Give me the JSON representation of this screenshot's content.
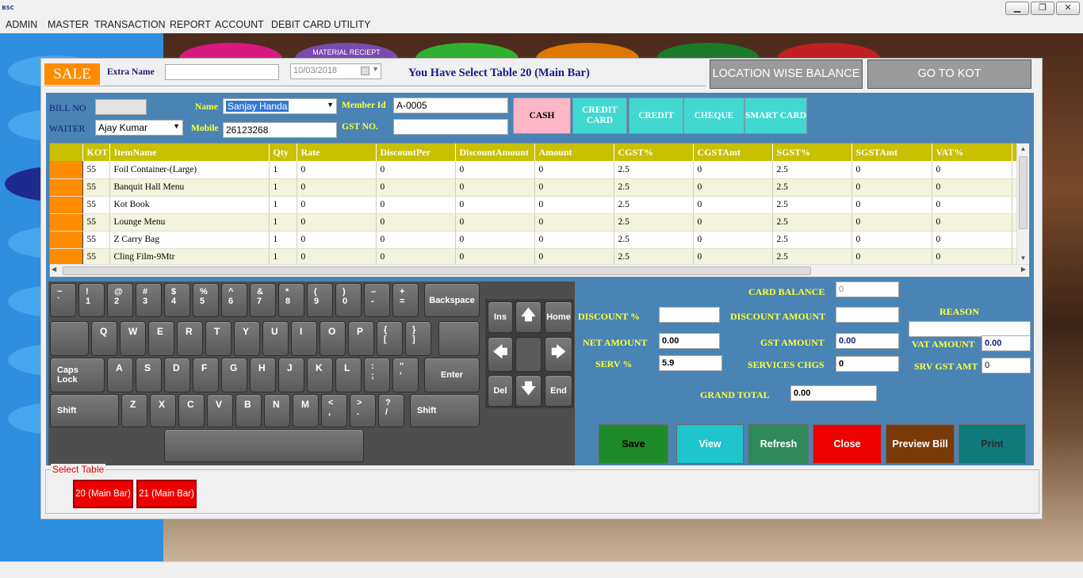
{
  "app": {
    "icon_text": "BSC"
  },
  "window_controls": {
    "minimize": "▁",
    "restore": "❐",
    "close": "✕"
  },
  "menu": [
    "ADMIN",
    "MASTER",
    "TRANSACTION",
    "REPORT",
    "ACCOUNT",
    "DEBIT CARD",
    "UTILITY"
  ],
  "background_fragment": "MATERIAL RECIEPT",
  "header": {
    "sale_label": "SALE",
    "extra_name_label": "Extra Name",
    "extra_name_value": "",
    "date_value": "10/03/2018",
    "table_message": "You Have Select Table 20 (Main Bar)",
    "location_balance_label": "LOCATION WISE BALANCE",
    "go_to_kot_label": "GO TO KOT"
  },
  "form": {
    "bill_no_label": "BILL NO",
    "bill_no_value": "",
    "waiter_label": "WAITER",
    "waiter_value": "Ajay Kumar",
    "name_label": "Name",
    "name_value": "Sanjay  Handa",
    "mobile_label": "Mobile",
    "mobile_value": "26123268",
    "member_id_label": "Member Id",
    "member_id_value": "A-0005",
    "gst_no_label": "GST NO.",
    "gst_no_value": ""
  },
  "payment_modes": [
    {
      "label": "CASH",
      "color": "#ffb6c6",
      "text_color": "#000000"
    },
    {
      "label": "CREDIT CARD",
      "color": "#40d8d0",
      "text_color": "#ffffff"
    },
    {
      "label": "CREDIT",
      "color": "#40d8d0",
      "text_color": "#ffffff"
    },
    {
      "label": "CHEQUE",
      "color": "#40d8d0",
      "text_color": "#ffffff"
    },
    {
      "label": "SMART CARD",
      "color": "#40d8d0",
      "text_color": "#ffffff"
    }
  ],
  "grid": {
    "columns": [
      "KOT",
      "ItemName",
      "Qty",
      "Rate",
      "DiscountPer",
      "DiscountAmount",
      "Amount",
      "CGST%",
      "CGSTAmt",
      "SGST%",
      "SGSTAmt",
      "VAT%",
      "V"
    ],
    "rows": [
      [
        "55",
        "Foil Container-(Large)",
        "1",
        "0",
        "0",
        "0",
        "0",
        "2.5",
        "0",
        "2.5",
        "0",
        "0",
        "0"
      ],
      [
        "55",
        "Banquit Hall Menu",
        "1",
        "0",
        "0",
        "0",
        "0",
        "2.5",
        "0",
        "2.5",
        "0",
        "0",
        "0"
      ],
      [
        "55",
        "Kot Book",
        "1",
        "0",
        "0",
        "0",
        "0",
        "2.5",
        "0",
        "2.5",
        "0",
        "0",
        "0"
      ],
      [
        "55",
        "Lounge Menu",
        "1",
        "0",
        "0",
        "0",
        "0",
        "2.5",
        "0",
        "2.5",
        "0",
        "0",
        "0"
      ],
      [
        "55",
        "Z Carry Bag",
        "1",
        "0",
        "0",
        "0",
        "0",
        "2.5",
        "0",
        "2.5",
        "0",
        "0",
        "0"
      ],
      [
        "55",
        "Cling Film-9Mtr",
        "1",
        "0",
        "0",
        "0",
        "0",
        "2.5",
        "0",
        "2.5",
        "0",
        "0",
        "0"
      ]
    ]
  },
  "keyboard": {
    "number_row": [
      {
        "top": "~",
        "bottom": "`"
      },
      {
        "top": "!",
        "bottom": "1"
      },
      {
        "top": "@",
        "bottom": "2"
      },
      {
        "top": "#",
        "bottom": "3"
      },
      {
        "top": "$",
        "bottom": "4"
      },
      {
        "top": "%",
        "bottom": "5"
      },
      {
        "top": "^",
        "bottom": "6"
      },
      {
        "top": "&",
        "bottom": "7"
      },
      {
        "top": "*",
        "bottom": "8"
      },
      {
        "top": "(",
        "bottom": "9"
      },
      {
        "top": ")",
        "bottom": "0"
      },
      {
        "top": "–",
        "bottom": "-"
      },
      {
        "top": "+",
        "bottom": "="
      }
    ],
    "backspace": "Backspace",
    "q_row": [
      "Q",
      "W",
      "E",
      "R",
      "T",
      "Y",
      "U",
      "I",
      "O",
      "P"
    ],
    "q_row_brackets": [
      {
        "top": "{",
        "bottom": "["
      },
      {
        "top": "}",
        "bottom": "]"
      }
    ],
    "caps_lock": "Caps Lock",
    "a_row": [
      "A",
      "S",
      "D",
      "F",
      "G",
      "H",
      "J",
      "K",
      "L"
    ],
    "a_row_punct": [
      {
        "top": ":",
        "bottom": ";"
      },
      {
        "top": "\"",
        "bottom": "'"
      }
    ],
    "enter": "Enter",
    "shift": "Shift",
    "z_row": [
      "Z",
      "X",
      "C",
      "V",
      "B",
      "N",
      "M"
    ],
    "z_row_punct": [
      {
        "top": "<",
        "bottom": ","
      },
      {
        "top": ">",
        "bottom": "."
      },
      {
        "top": "?",
        "bottom": "/"
      }
    ],
    "nav": {
      "ins": "Ins",
      "home": "Home",
      "del": "Del",
      "end": "End",
      "up": "🡅",
      "down": "🡇",
      "left": "🡄",
      "right": "🡆"
    }
  },
  "totals": {
    "card_balance_label": "CARD BALANCE",
    "card_balance_value": "0",
    "discount_pct_label": "DISCOUNT %",
    "discount_pct_value": "",
    "discount_amount_label": "DISCOUNT AMOUNT",
    "discount_amount_value": "",
    "reason_label": "REASON",
    "reason_value": "",
    "net_amount_label": "NET AMOUNT",
    "net_amount_value": "0.00",
    "gst_amount_label": "GST AMOUNT",
    "gst_amount_value": "0.00",
    "vat_amount_label": "VAT AMOUNT",
    "vat_amount_value": "0.00",
    "serv_pct_label": "SERV %",
    "serv_pct_value": "5.9",
    "services_chgs_label": "SERVICES CHGS",
    "services_chgs_value": "0",
    "srv_gst_amt_label": "SRV GST AMT",
    "srv_gst_amt_value": "0",
    "grand_total_label": "GRAND TOTAL",
    "grand_total_value": "0.00"
  },
  "actions": [
    {
      "label": "Save",
      "color": "#1f8a2a"
    },
    {
      "label": "View",
      "color": "#1ec4cc"
    },
    {
      "label": "Refresh",
      "color": "#2e8a5a"
    },
    {
      "label": "Close",
      "color": "#ee0000"
    },
    {
      "label": "Preview Bill",
      "color": "#7a3a08"
    },
    {
      "label": "Print",
      "color": "#0e7a7a"
    }
  ],
  "select_table": {
    "legend": "Select Table",
    "tables": [
      "20 (Main Bar)",
      "21 (Main Bar)"
    ]
  }
}
